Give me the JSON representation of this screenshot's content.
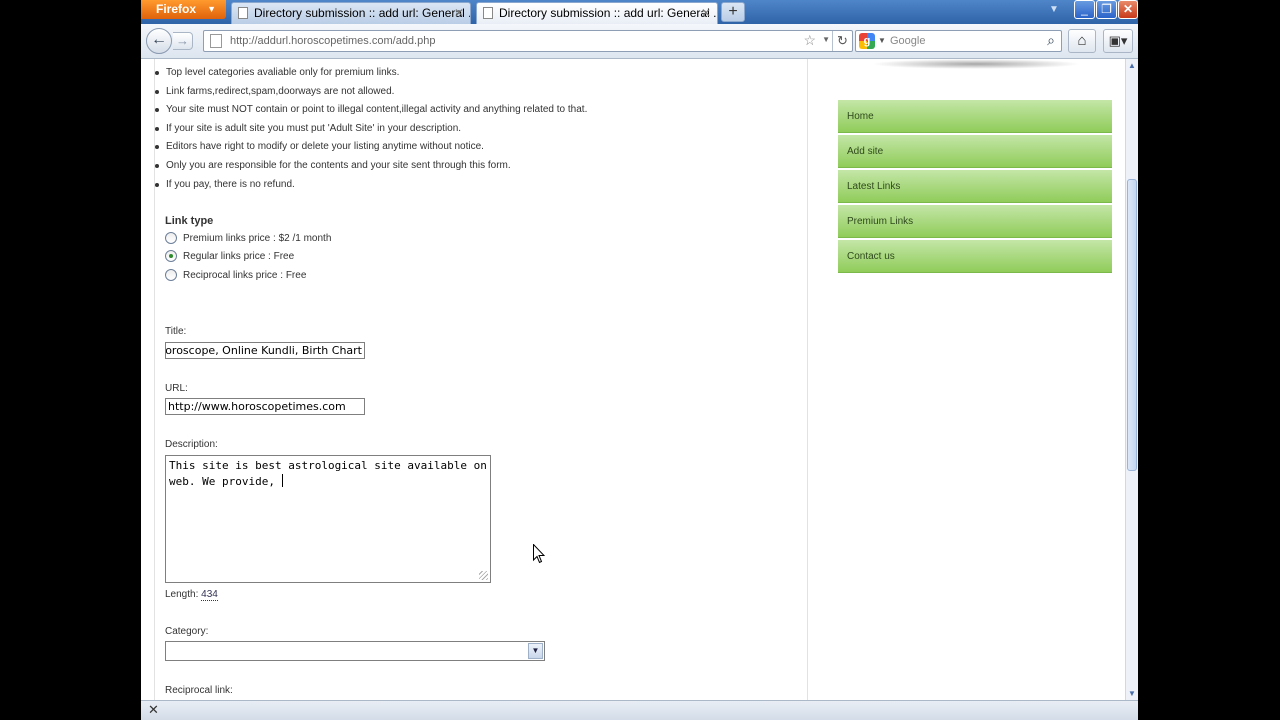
{
  "browser": {
    "app_button": "Firefox",
    "tabs": [
      {
        "label": "Directory submission :: add url: General ..."
      },
      {
        "label": "Directory submission :: add url: General ..."
      }
    ],
    "url": "http://addurl.horoscopetimes.com/add.php",
    "search_placeholder": "Google"
  },
  "rules": [
    "Top level categories avaliable only for premium links.",
    "Link farms,redirect,spam,doorways are not allowed.",
    "Your site must NOT contain or point to illegal content,illegal activity and anything related to that.",
    "If your site is adult site you must put 'Adult Site' in your description.",
    "Editors have right to modify or delete your listing anytime without notice.",
    "Only you are responsible for the contents and your site sent through this form.",
    "If you pay, there is no refund."
  ],
  "link_type": {
    "label": "Link type",
    "options": [
      {
        "label": "Premium links price : $2 /1 month",
        "selected": false
      },
      {
        "label": "Regular links price : Free",
        "selected": true
      },
      {
        "label": "Reciprocal links price : Free",
        "selected": false
      }
    ]
  },
  "form": {
    "title_label": "Title:",
    "title_value": "Horoscope, Online Kundli, Birth Chart",
    "url_label": "URL:",
    "url_value": "http://www.horoscopetimes.com",
    "description_label": "Description:",
    "description_value": "This site is best astrological site available on web. We provide, ",
    "length_label": "Length:",
    "length_value": "434",
    "category_label": "Category:",
    "category_value": "",
    "reciprocal_label": "Reciprocal link:"
  },
  "sidebar": {
    "items": [
      {
        "label": "Home"
      },
      {
        "label": "Add site"
      },
      {
        "label": "Latest Links"
      },
      {
        "label": "Premium Links"
      },
      {
        "label": "Contact us"
      }
    ]
  },
  "colors": {
    "menu_green": "#90cc5a",
    "tab_blue": "#2f63a8",
    "firefox_orange": "#e0620b"
  }
}
